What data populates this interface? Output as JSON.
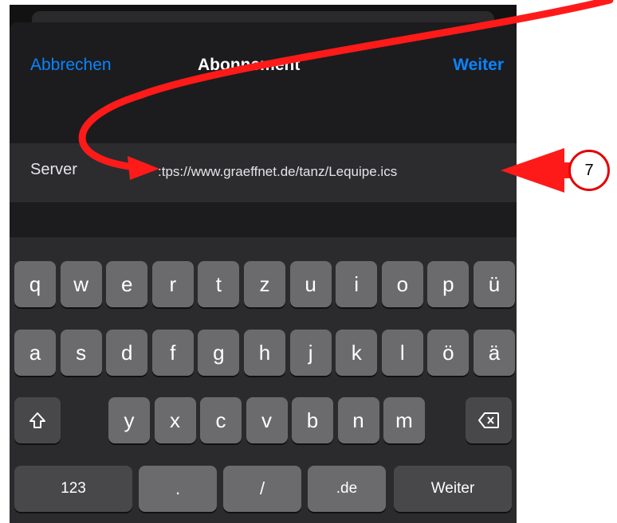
{
  "header": {
    "cancel_label": "Abbrechen",
    "title": "Abonnement",
    "next_label": "Weiter"
  },
  "server_field": {
    "label": "Server",
    "value": ":tps://www.graeffnet.de/tanz/Lequipe.ics"
  },
  "keyboard": {
    "row1": [
      "q",
      "w",
      "e",
      "r",
      "t",
      "z",
      "u",
      "i",
      "o",
      "p",
      "ü"
    ],
    "row2": [
      "a",
      "s",
      "d",
      "f",
      "g",
      "h",
      "j",
      "k",
      "l",
      "ö",
      "ä"
    ],
    "row3": [
      "y",
      "x",
      "c",
      "v",
      "b",
      "n",
      "m"
    ],
    "shift_icon": "shift-arrow-icon",
    "delete_icon": "backspace-icon",
    "bottom": {
      "numbers": "123",
      "dot": ".",
      "slash": "/",
      "domain": ".de",
      "return": "Weiter"
    }
  },
  "annotation": {
    "step_number": "7",
    "arrow_color": "#ff1a1a",
    "badge_border_color": "#e30000"
  },
  "colors": {
    "accent": "#0a84ff",
    "key": "#6b6b6e",
    "function_key": "#48484a",
    "background": "#121212"
  }
}
